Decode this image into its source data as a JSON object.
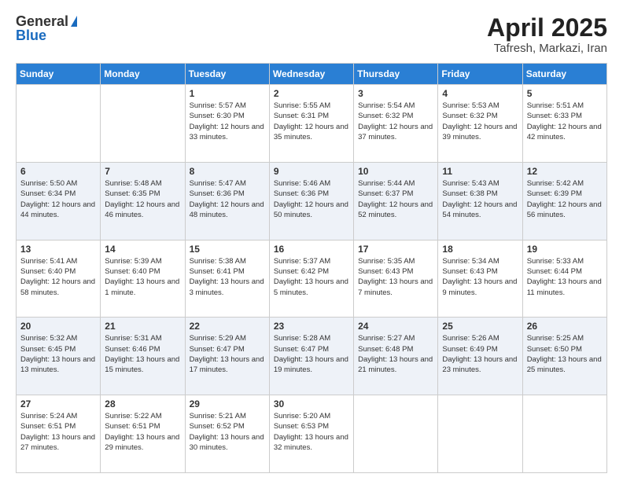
{
  "header": {
    "logo_general": "General",
    "logo_blue": "Blue",
    "title": "April 2025",
    "location": "Tafresh, Markazi, Iran"
  },
  "days_of_week": [
    "Sunday",
    "Monday",
    "Tuesday",
    "Wednesday",
    "Thursday",
    "Friday",
    "Saturday"
  ],
  "weeks": [
    [
      {
        "day": "",
        "info": ""
      },
      {
        "day": "",
        "info": ""
      },
      {
        "day": "1",
        "info": "Sunrise: 5:57 AM\nSunset: 6:30 PM\nDaylight: 12 hours and 33 minutes."
      },
      {
        "day": "2",
        "info": "Sunrise: 5:55 AM\nSunset: 6:31 PM\nDaylight: 12 hours and 35 minutes."
      },
      {
        "day": "3",
        "info": "Sunrise: 5:54 AM\nSunset: 6:32 PM\nDaylight: 12 hours and 37 minutes."
      },
      {
        "day": "4",
        "info": "Sunrise: 5:53 AM\nSunset: 6:32 PM\nDaylight: 12 hours and 39 minutes."
      },
      {
        "day": "5",
        "info": "Sunrise: 5:51 AM\nSunset: 6:33 PM\nDaylight: 12 hours and 42 minutes."
      }
    ],
    [
      {
        "day": "6",
        "info": "Sunrise: 5:50 AM\nSunset: 6:34 PM\nDaylight: 12 hours and 44 minutes."
      },
      {
        "day": "7",
        "info": "Sunrise: 5:48 AM\nSunset: 6:35 PM\nDaylight: 12 hours and 46 minutes."
      },
      {
        "day": "8",
        "info": "Sunrise: 5:47 AM\nSunset: 6:36 PM\nDaylight: 12 hours and 48 minutes."
      },
      {
        "day": "9",
        "info": "Sunrise: 5:46 AM\nSunset: 6:36 PM\nDaylight: 12 hours and 50 minutes."
      },
      {
        "day": "10",
        "info": "Sunrise: 5:44 AM\nSunset: 6:37 PM\nDaylight: 12 hours and 52 minutes."
      },
      {
        "day": "11",
        "info": "Sunrise: 5:43 AM\nSunset: 6:38 PM\nDaylight: 12 hours and 54 minutes."
      },
      {
        "day": "12",
        "info": "Sunrise: 5:42 AM\nSunset: 6:39 PM\nDaylight: 12 hours and 56 minutes."
      }
    ],
    [
      {
        "day": "13",
        "info": "Sunrise: 5:41 AM\nSunset: 6:40 PM\nDaylight: 12 hours and 58 minutes."
      },
      {
        "day": "14",
        "info": "Sunrise: 5:39 AM\nSunset: 6:40 PM\nDaylight: 13 hours and 1 minute."
      },
      {
        "day": "15",
        "info": "Sunrise: 5:38 AM\nSunset: 6:41 PM\nDaylight: 13 hours and 3 minutes."
      },
      {
        "day": "16",
        "info": "Sunrise: 5:37 AM\nSunset: 6:42 PM\nDaylight: 13 hours and 5 minutes."
      },
      {
        "day": "17",
        "info": "Sunrise: 5:35 AM\nSunset: 6:43 PM\nDaylight: 13 hours and 7 minutes."
      },
      {
        "day": "18",
        "info": "Sunrise: 5:34 AM\nSunset: 6:43 PM\nDaylight: 13 hours and 9 minutes."
      },
      {
        "day": "19",
        "info": "Sunrise: 5:33 AM\nSunset: 6:44 PM\nDaylight: 13 hours and 11 minutes."
      }
    ],
    [
      {
        "day": "20",
        "info": "Sunrise: 5:32 AM\nSunset: 6:45 PM\nDaylight: 13 hours and 13 minutes."
      },
      {
        "day": "21",
        "info": "Sunrise: 5:31 AM\nSunset: 6:46 PM\nDaylight: 13 hours and 15 minutes."
      },
      {
        "day": "22",
        "info": "Sunrise: 5:29 AM\nSunset: 6:47 PM\nDaylight: 13 hours and 17 minutes."
      },
      {
        "day": "23",
        "info": "Sunrise: 5:28 AM\nSunset: 6:47 PM\nDaylight: 13 hours and 19 minutes."
      },
      {
        "day": "24",
        "info": "Sunrise: 5:27 AM\nSunset: 6:48 PM\nDaylight: 13 hours and 21 minutes."
      },
      {
        "day": "25",
        "info": "Sunrise: 5:26 AM\nSunset: 6:49 PM\nDaylight: 13 hours and 23 minutes."
      },
      {
        "day": "26",
        "info": "Sunrise: 5:25 AM\nSunset: 6:50 PM\nDaylight: 13 hours and 25 minutes."
      }
    ],
    [
      {
        "day": "27",
        "info": "Sunrise: 5:24 AM\nSunset: 6:51 PM\nDaylight: 13 hours and 27 minutes."
      },
      {
        "day": "28",
        "info": "Sunrise: 5:22 AM\nSunset: 6:51 PM\nDaylight: 13 hours and 29 minutes."
      },
      {
        "day": "29",
        "info": "Sunrise: 5:21 AM\nSunset: 6:52 PM\nDaylight: 13 hours and 30 minutes."
      },
      {
        "day": "30",
        "info": "Sunrise: 5:20 AM\nSunset: 6:53 PM\nDaylight: 13 hours and 32 minutes."
      },
      {
        "day": "",
        "info": ""
      },
      {
        "day": "",
        "info": ""
      },
      {
        "day": "",
        "info": ""
      }
    ]
  ]
}
